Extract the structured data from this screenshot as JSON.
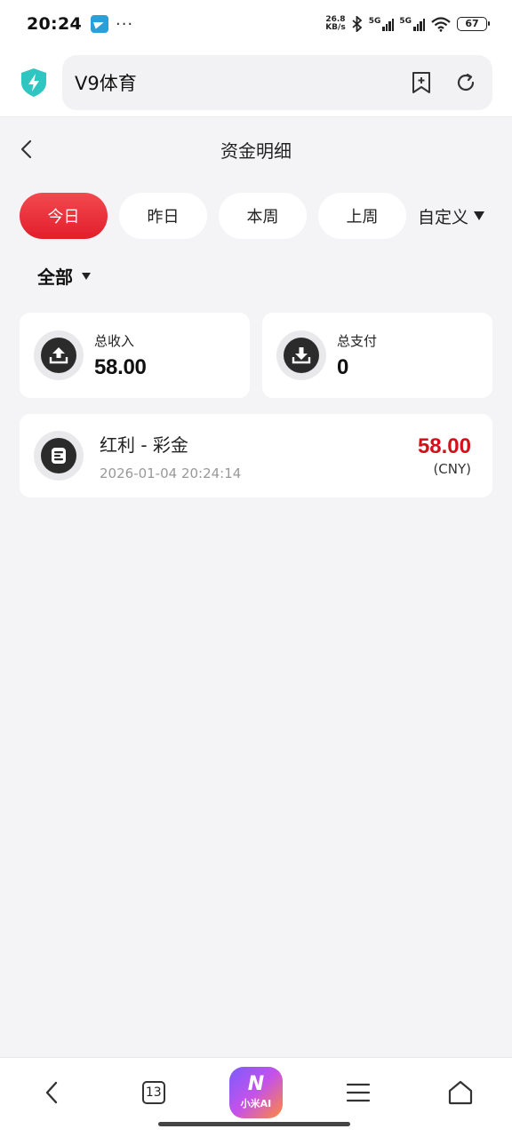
{
  "status_bar": {
    "time": "20:24",
    "dots": "···",
    "net_speed_value": "26.8",
    "net_speed_unit": "KB/s",
    "sim1": "5G",
    "sim2": "5G",
    "battery": "67",
    "icons": [
      "telegram-icon",
      "bluetooth-icon",
      "signal-icon",
      "wifi-icon",
      "battery-icon"
    ]
  },
  "browser": {
    "url_text": "V9体育",
    "icons": [
      "shield-icon",
      "bookmark-add-icon",
      "refresh-icon"
    ]
  },
  "header": {
    "title": "资金明细"
  },
  "tabs": [
    {
      "label": "今日",
      "active": true
    },
    {
      "label": "昨日",
      "active": false
    },
    {
      "label": "本周",
      "active": false
    },
    {
      "label": "上周",
      "active": false
    }
  ],
  "custom_tab": "自定义",
  "category": "全部",
  "summary": {
    "income_label": "总收入",
    "income_value": "58.00",
    "expense_label": "总支付",
    "expense_value": "0"
  },
  "records": [
    {
      "title": "红利 - 彩金",
      "time": "2026-01-04 20:24:14",
      "amount": "58.00",
      "currency": "(CNY)"
    }
  ],
  "bottom_nav": {
    "tab_count": "13",
    "ai_glyph": "N",
    "ai_label": "小米AI"
  },
  "colors": {
    "accent": "#e31e2b",
    "amount": "#d4111b",
    "background": "#f4f4f6",
    "shield": "#2fc5c0"
  }
}
